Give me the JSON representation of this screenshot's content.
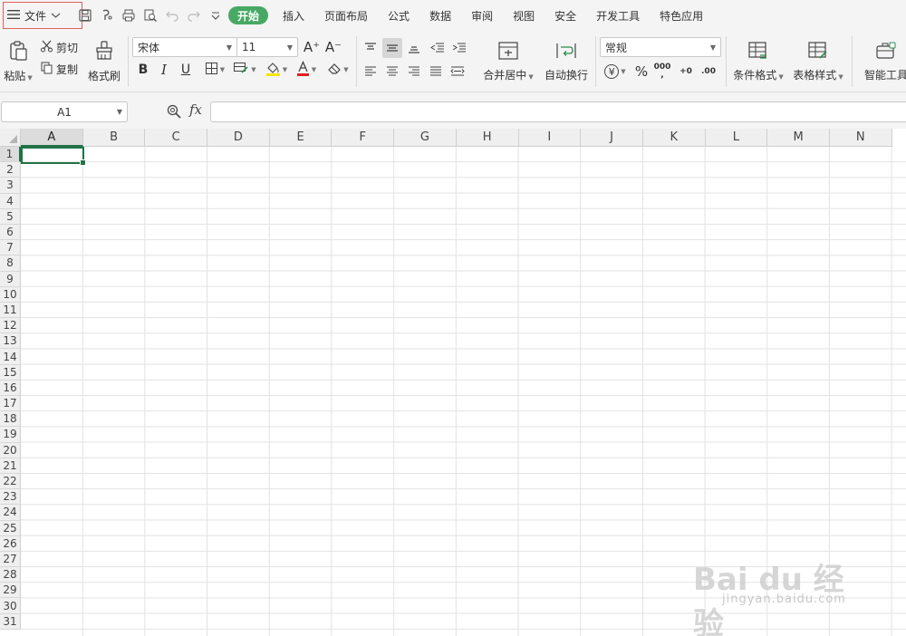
{
  "menubar": {
    "file_label": "文件",
    "tabs": [
      {
        "label": "开始",
        "active": true
      },
      {
        "label": "插入"
      },
      {
        "label": "页面布局"
      },
      {
        "label": "公式"
      },
      {
        "label": "数据"
      },
      {
        "label": "审阅"
      },
      {
        "label": "视图"
      },
      {
        "label": "安全"
      },
      {
        "label": "开发工具"
      },
      {
        "label": "特色应用"
      }
    ],
    "quick_icons": [
      "save-icon",
      "format-painter-mini-icon",
      "print-icon",
      "print-preview-icon",
      "undo-icon",
      "redo-icon",
      "customize-dropdown-icon"
    ]
  },
  "ribbon": {
    "paste_label": "粘贴",
    "cut_label": "剪切",
    "copy_label": "复制",
    "format_painter_label": "格式刷",
    "font_name": "宋体",
    "font_size": "11",
    "bold": "B",
    "italic": "I",
    "underline": "U",
    "increase_font": "A⁺",
    "decrease_font": "A⁻",
    "merge_center_label": "合并居中",
    "wrap_text_label": "自动换行",
    "number_format": "常规",
    "currency_symbol": "¥",
    "percent_symbol": "%",
    "thousands_symbol": "000",
    "increase_decimal": "+0",
    "decrease_decimal": ".00",
    "conditional_format_label": "条件格式",
    "table_style_label": "表格样式",
    "smart_toolbox_label": "智能工具箱",
    "accent_color": "#47a964"
  },
  "formula_bar": {
    "name_box": "A1",
    "fx_label": "fx",
    "formula_value": ""
  },
  "grid": {
    "columns": [
      "A",
      "B",
      "C",
      "D",
      "E",
      "F",
      "G",
      "H",
      "I",
      "J",
      "K",
      "L",
      "M",
      "N"
    ],
    "rows": [
      "1",
      "2",
      "3",
      "4",
      "5",
      "6",
      "7",
      "8",
      "9",
      "10",
      "11",
      "12",
      "13",
      "14",
      "15",
      "16",
      "17",
      "18",
      "19",
      "20",
      "21",
      "22",
      "23",
      "24",
      "25",
      "26",
      "27",
      "28",
      "29",
      "30",
      "31"
    ],
    "active_cell": "A1",
    "selection_color": "#217346"
  },
  "watermark": {
    "main": "Bai du 经验",
    "sub": "jingyan.baidu.com"
  }
}
